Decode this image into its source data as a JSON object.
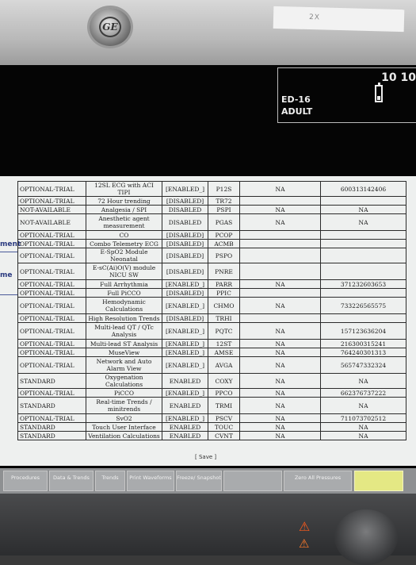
{
  "device": {
    "logo_text": "GE",
    "sticker_text": "2X",
    "time": "10 10",
    "unit_name": "ED-16",
    "patient_type": "ADULT"
  },
  "side_labels": [
    "ment",
    "me"
  ],
  "options_table": {
    "rows": [
      [
        "OPTIONAL-TRIAL",
        "12SL ECG with ACI TIPI",
        "[ENABLED_]",
        "P12S",
        "NA",
        "600313142406"
      ],
      [
        "OPTIONAL-TRIAL",
        "72 Hour trending",
        "[DISABLED]",
        "TR72",
        "",
        ""
      ],
      [
        "NOT-AVAILABLE",
        "Analgesia / SPI",
        "DISABLED",
        "PSPI",
        "NA",
        "NA"
      ],
      [
        "NOT-AVAILABLE",
        "Anesthetic agent measurement",
        "DISABLED",
        "PGAS",
        "NA",
        "NA"
      ],
      [
        "OPTIONAL-TRIAL",
        "CO",
        "[DISABLED]",
        "PCOP",
        "",
        ""
      ],
      [
        "OPTIONAL-TRIAL",
        "Combo Telemetry ECG",
        "[DISABLED]",
        "ACMB",
        "",
        ""
      ],
      [
        "OPTIONAL-TRIAL",
        "E-SpO2 Module Neonatal",
        "[DISABLED]",
        "PSPO",
        "",
        ""
      ],
      [
        "OPTIONAL-TRIAL",
        "E-sC(Ai)O(V) module NICU SW",
        "[DISABLED]",
        "PNRE",
        "",
        ""
      ],
      [
        "OPTIONAL-TRIAL",
        "Full Arrhythmia",
        "[ENABLED_]",
        "PARR",
        "NA",
        "371232603653"
      ],
      [
        "OPTIONAL-TRIAL",
        "Full PiCCO",
        "[DISABLED]",
        "PPIC",
        "",
        ""
      ],
      [
        "OPTIONAL-TRIAL",
        "Hemodynamic Calculations",
        "[ENABLED_]",
        "CHMO",
        "NA",
        "733226565575"
      ],
      [
        "OPTIONAL-TRIAL",
        "High Resolution Trends",
        "[DISABLED]",
        "TRHI",
        "",
        ""
      ],
      [
        "OPTIONAL-TRIAL",
        "Multi-lead QT / QTc Analysis",
        "[ENABLED_]",
        "PQTC",
        "NA",
        "157123636204"
      ],
      [
        "OPTIONAL-TRIAL",
        "Multi-lead ST Analysis",
        "[ENABLED_]",
        "12ST",
        "NA",
        "216300315241"
      ],
      [
        "OPTIONAL-TRIAL",
        "MuseView",
        "[ENABLED_]",
        "AMSE",
        "NA",
        "764240301313"
      ],
      [
        "OPTIONAL-TRIAL",
        "Network and Auto Alarm View",
        "[ENABLED_]",
        "AVGA",
        "NA",
        "565747332324"
      ],
      [
        "STANDARD",
        "Oxygenation Calculations",
        "ENABLED",
        "COXY",
        "NA",
        "NA"
      ],
      [
        "OPTIONAL-TRIAL",
        "PiCCO",
        "[ENABLED_]",
        "PPCO",
        "NA",
        "662376737222"
      ],
      [
        "STANDARD",
        "Real-time Trends / minitrends",
        "ENABLED",
        "TRMI",
        "NA",
        "NA"
      ],
      [
        "OPTIONAL-TRIAL",
        "SvO2",
        "[ENABLED_]",
        "PSCV",
        "NA",
        "711073702512"
      ],
      [
        "STANDARD",
        "Touch User Interface",
        "ENABLED",
        "TOUC",
        "NA",
        "NA"
      ],
      [
        "STANDARD",
        "Ventilation Calculations",
        "ENABLED",
        "CVNT",
        "NA",
        "NA"
      ]
    ]
  },
  "save_label": "[ Save ]",
  "softkeys": [
    {
      "label": "Procedures",
      "active": false
    },
    {
      "label": "Data & Trends",
      "active": false
    },
    {
      "label": "Trends",
      "active": false
    },
    {
      "label": "Print Waveforms",
      "active": false
    },
    {
      "label": "Freeze/ Snapshot",
      "active": false
    },
    {
      "label": "",
      "active": false
    },
    {
      "label": "Zero All Pressures",
      "active": false
    },
    {
      "label": "",
      "active": true
    }
  ],
  "icons": {
    "alarm": "alarm-bell-icon",
    "battery": "battery-icon"
  },
  "colors": {
    "panel": "#eef0ef",
    "screen": "#050505",
    "softkey": "#a9abad",
    "softkey_active": "#e4e884",
    "alarm": "#ff5a1a"
  }
}
